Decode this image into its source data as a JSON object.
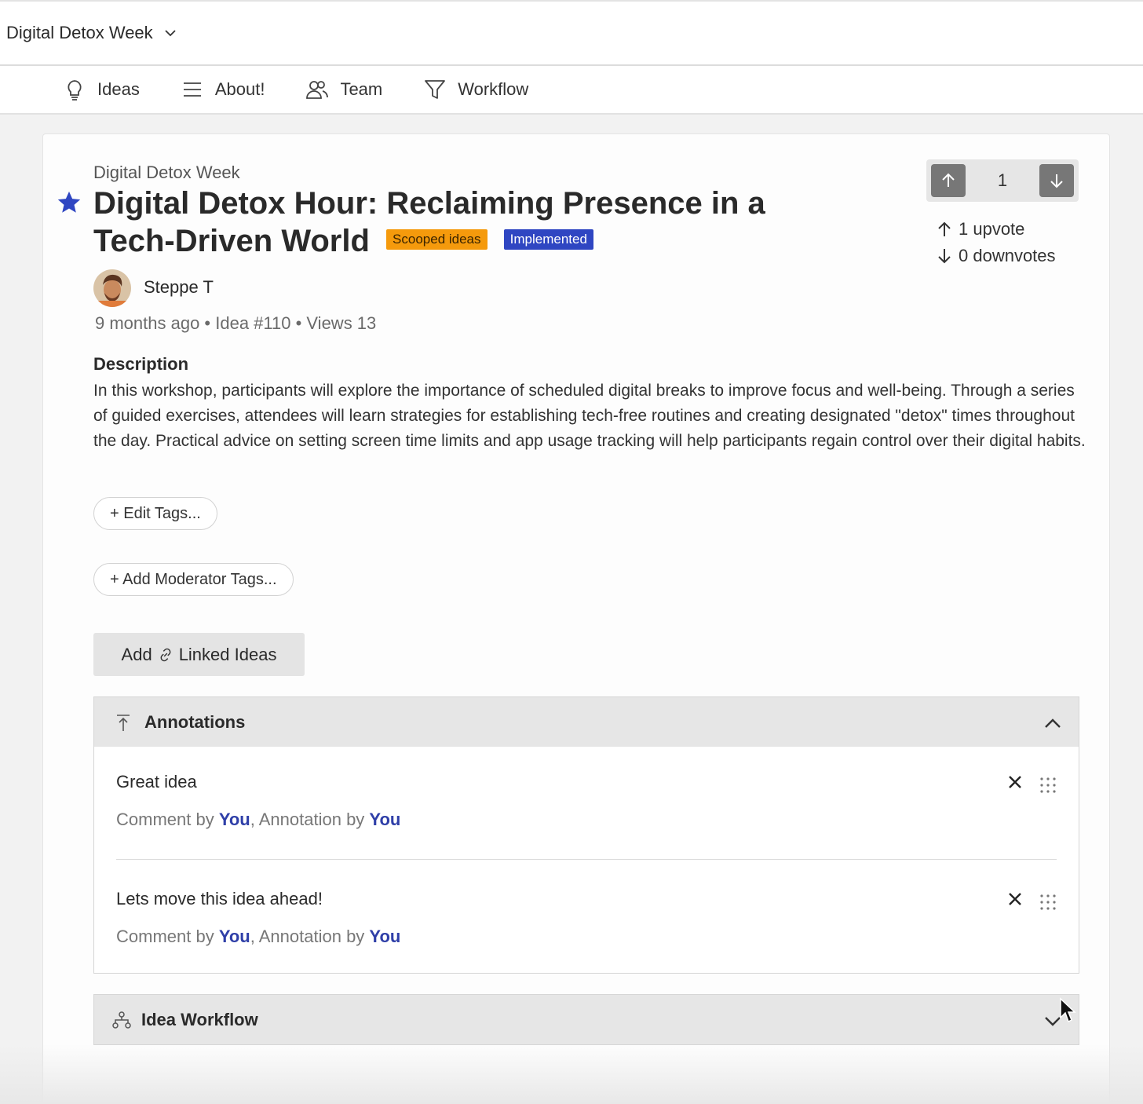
{
  "topbar": {
    "project_name": "Digital Detox Week",
    "dropdown_icon": "chevron-down-icon"
  },
  "nav": {
    "items": [
      {
        "label": "Ideas",
        "icon": "lightbulb-icon"
      },
      {
        "label": "About!",
        "icon": "menu-lines-icon"
      },
      {
        "label": "Team",
        "icon": "users-icon"
      },
      {
        "label": "Workflow",
        "icon": "funnel-icon"
      }
    ]
  },
  "idea": {
    "breadcrumb": "Digital Detox Week",
    "title": "Digital Detox Hour: Reclaiming Presence in a Tech-Driven World",
    "badges": [
      {
        "label": "Scooped ideas",
        "color": "#f59a0c"
      },
      {
        "label": "Implemented",
        "color": "#2f46c2"
      }
    ],
    "author": "Steppe T",
    "meta": "9 months ago  • Idea #110 • Views 13",
    "description_heading": "Description",
    "description": "In this workshop, participants will explore the importance of scheduled digital breaks to improve focus and well-being. Through a series of guided exercises, attendees will learn strategies for establishing tech-free routines and creating designated \"detox\" times throughout the day. Practical advice on setting screen time limits and app usage tracking will help participants regain control over their digital habits."
  },
  "votes": {
    "count": "1",
    "upvotes": "1 upvote",
    "downvotes": "0 downvotes"
  },
  "buttons": {
    "edit_tags": "+ Edit Tags...",
    "moderator_tags": "+ Add Moderator Tags...",
    "linked_add": "Add",
    "linked_label": "Linked Ideas"
  },
  "annotations": {
    "heading": "Annotations",
    "items": [
      {
        "text": "Great idea",
        "meta_prefix": "Comment by ",
        "comment_by": "You",
        "meta_mid": ", Annotation by ",
        "annotation_by": "You"
      },
      {
        "text": "Lets move this idea ahead!",
        "meta_prefix": "Comment by ",
        "comment_by": "You",
        "meta_mid": ", Annotation by ",
        "annotation_by": "You"
      }
    ]
  },
  "workflow_panel": {
    "heading": "Idea Workflow"
  },
  "colors": {
    "accent_blue": "#2f3fa8",
    "star": "#2f46c2",
    "badge_orange": "#f59a0c"
  }
}
